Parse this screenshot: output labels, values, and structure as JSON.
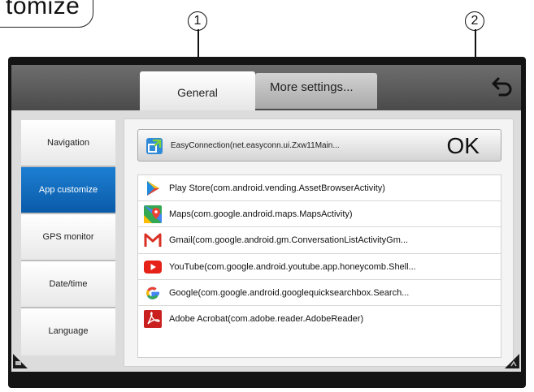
{
  "callout_pill": {
    "text": "tomize"
  },
  "annotations": [
    {
      "label": "1"
    },
    {
      "label": "2"
    }
  ],
  "tabs": [
    {
      "label": "General"
    },
    {
      "label": "More settings..."
    }
  ],
  "sidebar": {
    "items": [
      {
        "label": "Navigation",
        "active": false
      },
      {
        "label": "App customize",
        "active": true
      },
      {
        "label": "GPS monitor",
        "active": false
      },
      {
        "label": "Date/time",
        "active": false
      },
      {
        "label": "Language",
        "active": false
      }
    ]
  },
  "selection": {
    "label": "EasyConnection(net.easyconn.ui.Zxw11Main...",
    "ok_label": "OK",
    "icon": "easyconnection-icon"
  },
  "apps": [
    {
      "label": "Play Store(com.android.vending.AssetBrowserActivity)",
      "icon": "play-store-icon"
    },
    {
      "label": "Maps(com.google.android.maps.MapsActivity)",
      "icon": "maps-icon"
    },
    {
      "label": "Gmail(com.google.android.gm.ConversationListActivityGm...",
      "icon": "gmail-icon"
    },
    {
      "label": "YouTube(com.google.android.youtube.app.honeycomb.Shell...",
      "icon": "youtube-icon"
    },
    {
      "label": "Google(com.google.android.googlequicksearchbox.Search...",
      "icon": "google-icon"
    },
    {
      "label": "Adobe Acrobat(com.adobe.reader.AdobeReader)",
      "icon": "acrobat-icon"
    }
  ],
  "colors": {
    "active_tab_blue": "#0a5aa8",
    "frame": "#141414"
  }
}
